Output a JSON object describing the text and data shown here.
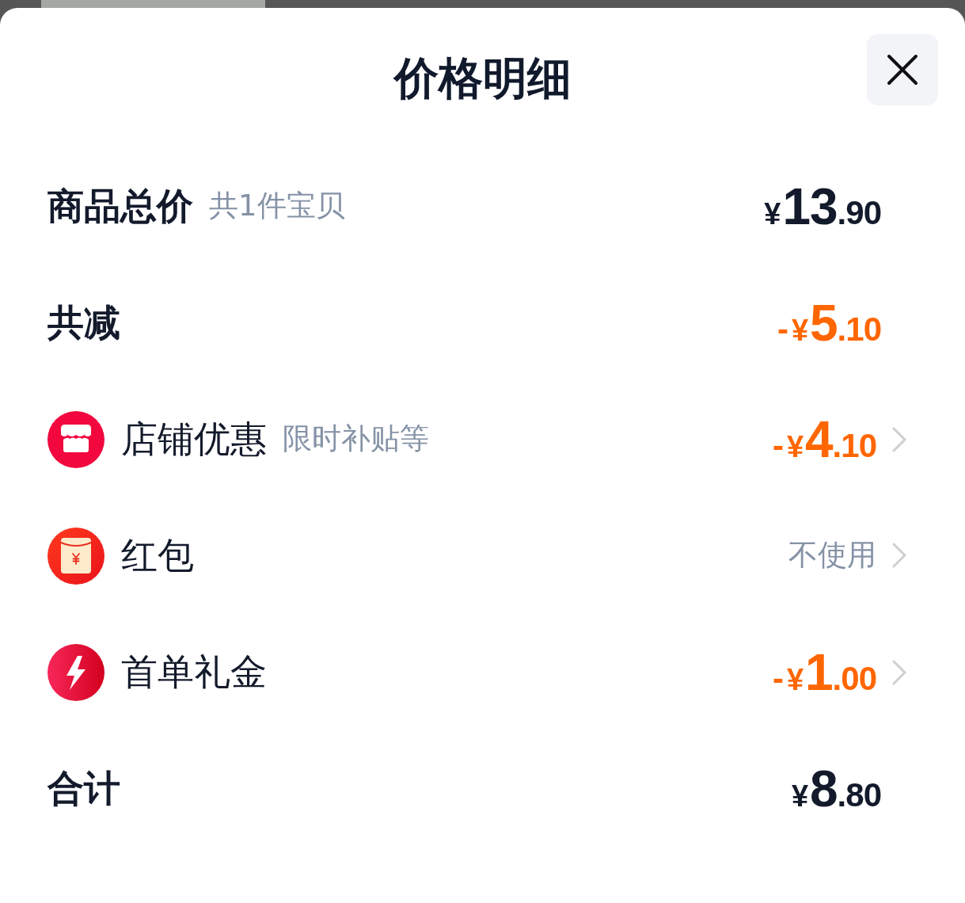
{
  "sheet": {
    "title": "价格明细"
  },
  "rows": [
    {
      "kind": "heading",
      "label": "商品总价",
      "note": "共1件宝贝",
      "amount": {
        "currency": "¥",
        "integer": "13",
        "fraction": ".90",
        "color": "#131a2b"
      },
      "chevron": false
    },
    {
      "kind": "heading",
      "label": "共减",
      "amount": {
        "sign": "-",
        "currency": "¥",
        "integer": "5",
        "fraction": ".10",
        "color": "#ff6600"
      },
      "chevron": false
    },
    {
      "kind": "item",
      "label": "店铺优惠",
      "note": "限时补贴等",
      "amount": {
        "sign": "-",
        "currency": "¥",
        "integer": "4",
        "fraction": ".10",
        "color": "#ff6600"
      },
      "chevron": true
    },
    {
      "kind": "item",
      "label": "红包",
      "value": "不使用",
      "chevron": true
    },
    {
      "kind": "item",
      "label": "首单礼金",
      "amount": {
        "sign": "-",
        "currency": "¥",
        "integer": "1",
        "fraction": ".00",
        "color": "#ff6600"
      },
      "chevron": true
    },
    {
      "kind": "heading",
      "label": "合计",
      "amount": {
        "currency": "¥",
        "integer": "8",
        "fraction": ".80",
        "color": "#131a2b"
      },
      "chevron": false
    }
  ]
}
